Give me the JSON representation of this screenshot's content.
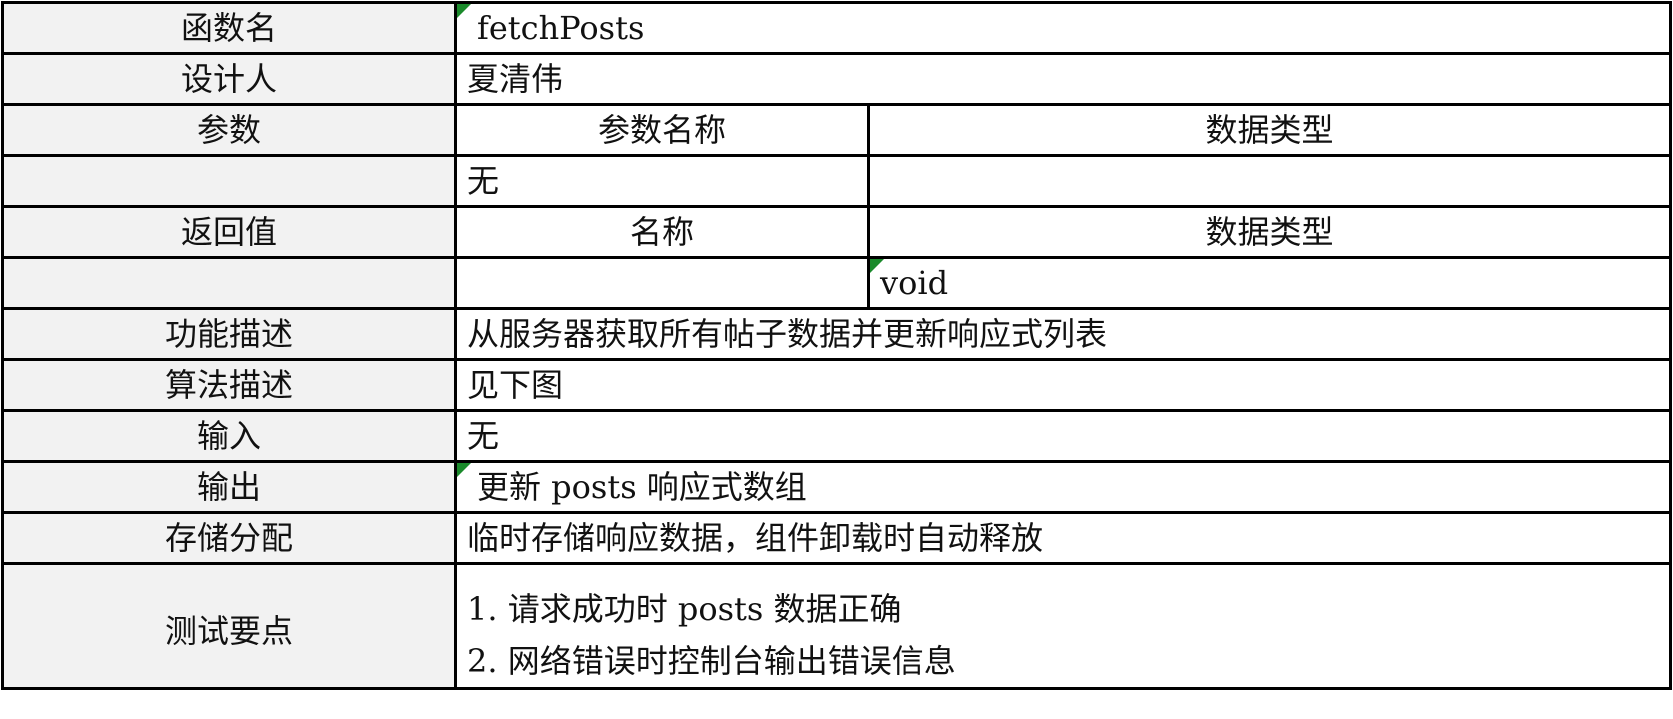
{
  "rows": {
    "function_name": {
      "label": "函数名",
      "value": "fetchPosts"
    },
    "designer": {
      "label": "设计人",
      "value": "夏清伟"
    },
    "params": {
      "label": "参数",
      "col_name": "参数名称",
      "col_type": "数据类型",
      "name": "无",
      "type": ""
    },
    "returns": {
      "label": "返回值",
      "col_name": "名称",
      "col_type": "数据类型",
      "name": "",
      "type": "void"
    },
    "description": {
      "label": "功能描述",
      "value": "从服务器获取所有帖子数据并更新响应式列表"
    },
    "algorithm": {
      "label": "算法描述",
      "value": "见下图"
    },
    "input": {
      "label": "输入",
      "value": "无"
    },
    "output": {
      "label": "输出",
      "value": "更新 posts 响应式数组"
    },
    "storage": {
      "label": "存储分配",
      "value": "临时存储响应数据，组件卸载时自动释放"
    },
    "test_points": {
      "label": "测试要点",
      "items": [
        "1. 请求成功时 posts 数据正确",
        "2. 网络错误时控制台输出错误信息"
      ]
    }
  }
}
